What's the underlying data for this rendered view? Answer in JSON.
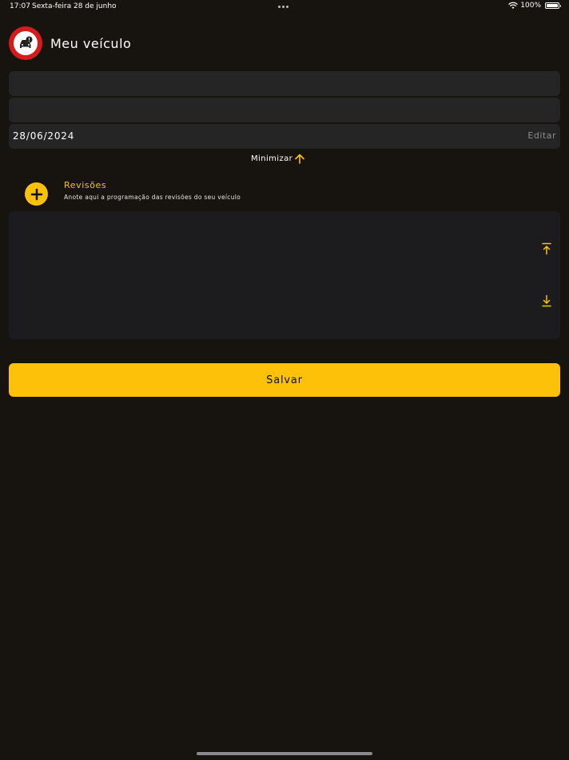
{
  "status_bar": {
    "time": "17:07",
    "date": "Sexta-feira 28 de junho",
    "battery": "100%",
    "icons": [
      "wifi-icon",
      "battery-icon"
    ]
  },
  "header": {
    "title": "Meu veículo",
    "logo_icon": "car-alert-icon"
  },
  "form": {
    "field1_value": "",
    "field2_value": "",
    "date_value": "28/06/2024",
    "edit_label": "Editar"
  },
  "minimize": {
    "label": "Minimizar",
    "icon": "arrow-up-icon"
  },
  "revisions": {
    "title": "Revisões",
    "description": "Anote aqui a programação das revisões do seu veículo",
    "add_icon": "plus-icon",
    "notes_value": "",
    "scroll_icons": [
      "scroll-to-top-icon",
      "scroll-to-bottom-icon"
    ]
  },
  "actions": {
    "save_label": "Salvar"
  },
  "colors": {
    "background": "#17140f",
    "accent": "#fdc10a",
    "field": "#252525",
    "logo_red": "#d41c1c"
  }
}
